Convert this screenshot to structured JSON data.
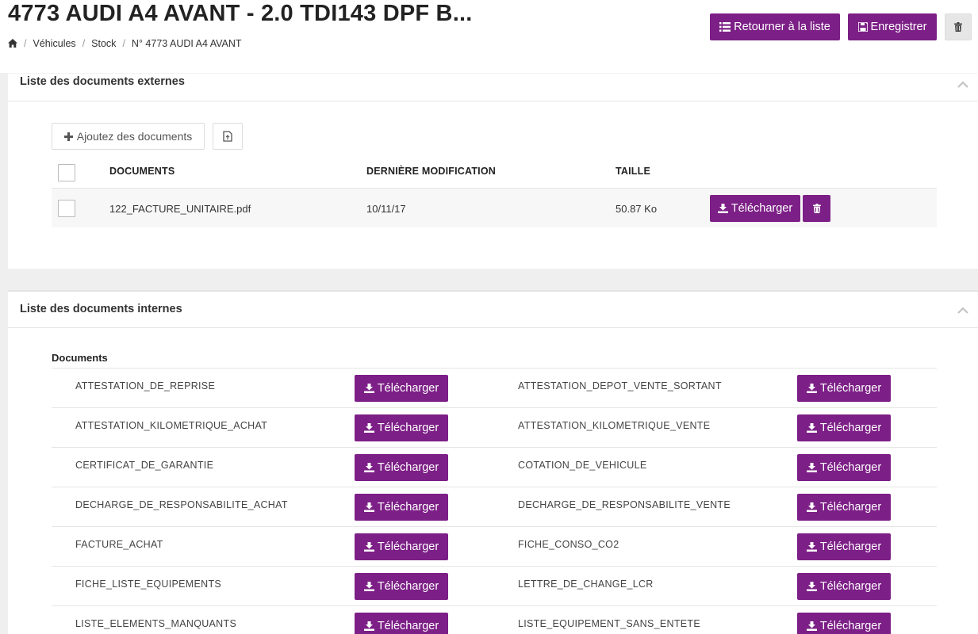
{
  "header": {
    "title": "4773 AUDI A4 AVANT - 2.0 TDI143 DPF B...",
    "breadcrumb": [
      "Véhicules",
      "Stock",
      "N° 4773 AUDI A4 AVANT"
    ],
    "back_label": "Retourner à la liste",
    "save_label": "Enregistrer"
  },
  "external": {
    "title": "Liste des documents externes",
    "add_label": "Ajoutez des documents",
    "columns": [
      "DOCUMENTS",
      "DERNIÈRE MODIFICATION",
      "TAILLE"
    ],
    "rows": [
      {
        "name": "122_FACTURE_UNITAIRE.pdf",
        "modified": "10/11/17",
        "size": "50.87 Ko",
        "download_label": "Télécharger"
      }
    ]
  },
  "internal": {
    "title": "Liste des documents internes",
    "section_label": "Documents",
    "download_label": "Télécharger",
    "rows": [
      {
        "left": "ATTESTATION_DE_REPRISE",
        "right": "ATTESTATION_DEPOT_VENTE_SORTANT"
      },
      {
        "left": "ATTESTATION_KILOMETRIQUE_ACHAT",
        "right": "ATTESTATION_KILOMETRIQUE_VENTE"
      },
      {
        "left": "CERTIFICAT_DE_GARANTIE",
        "right": "COTATION_DE_VEHICULE"
      },
      {
        "left": "DECHARGE_DE_RESPONSABILITE_ACHAT",
        "right": "DECHARGE_DE_RESPONSABILITE_VENTE"
      },
      {
        "left": "FACTURE_ACHAT",
        "right": "FICHE_CONSO_CO2"
      },
      {
        "left": "FICHE_LISTE_EQUIPEMENTS",
        "right": "LETTRE_DE_CHANGE_LCR"
      },
      {
        "left": "LISTE_ELEMENTS_MANQUANTS",
        "right": "LISTE_EQUIPEMENT_SANS_ENTETE"
      }
    ]
  },
  "colors": {
    "accent": "#7c1f86"
  },
  "icons": [
    "home-icon",
    "list-icon",
    "save-icon",
    "trash-icon",
    "chevron-up-icon",
    "plus-icon",
    "file-upload-icon",
    "download-icon"
  ]
}
